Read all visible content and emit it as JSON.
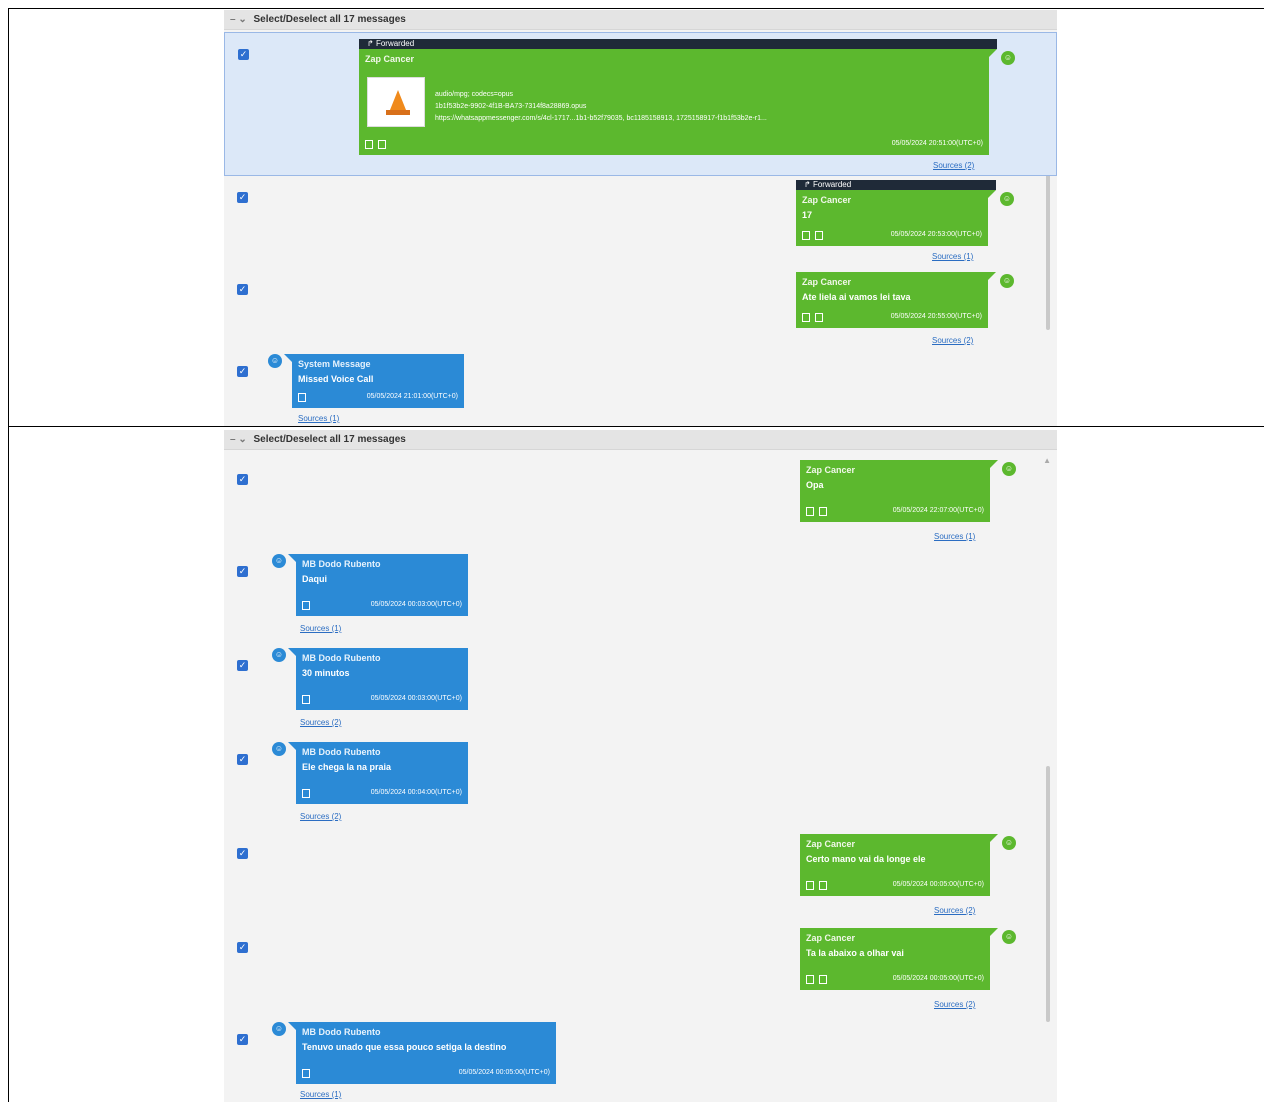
{
  "header": {
    "select_all_top": "Select/Deselect all 17 messages",
    "select_all_bottom": "Select/Deselect all 17 messages"
  },
  "labels": {
    "forwarded": "Forwarded",
    "sources_1": "Sources (1)",
    "sources_2": "Sources (2)"
  },
  "colors": {
    "green": "#5cb82e",
    "blue": "#2b8ad6",
    "dark": "#1f2a38",
    "check": "#2e6fd0"
  },
  "top_panel": {
    "messages": [
      {
        "sender": "Zap Cancer",
        "file_lines": [
          "audio/mpg; codecs=opus",
          "1b1f53b2e-9902-4f1B-BA73-7314f8a28869.opus",
          "https://whatsappmessenger.com/s/4cl-1717...1b1-b52f79035, bc1185158913, 1725158917-f1b1f53b2e-r1..."
        ],
        "timestamp": "05/05/2024 20:51:00(UTC+0)",
        "sources": "Sources (2)"
      },
      {
        "sender": "Zap Cancer",
        "text": "17",
        "timestamp": "05/05/2024 20:53:00(UTC+0)",
        "sources": "Sources (1)"
      },
      {
        "sender": "Zap Cancer",
        "text": "Ate liela ai vamos lei tava",
        "timestamp": "05/05/2024 20:55:00(UTC+0)",
        "sources": "Sources (2)"
      },
      {
        "sender": "System Message",
        "text": "Missed Voice Call",
        "timestamp": "05/05/2024 21:01:00(UTC+0)",
        "sources": "Sources (1)"
      }
    ]
  },
  "bottom_panel": {
    "messages": [
      {
        "sender": "Zap Cancer",
        "text": "Opa",
        "timestamp": "05/05/2024 22:07:00(UTC+0)",
        "sources": "Sources (1)"
      },
      {
        "sender": "MB Dodo Rubento",
        "text": "Daqui",
        "timestamp": "05/05/2024 00:03:00(UTC+0)",
        "sources": "Sources (1)"
      },
      {
        "sender": "MB Dodo Rubento",
        "text": "30 minutos",
        "timestamp": "05/05/2024 00:03:00(UTC+0)",
        "sources": "Sources (2)"
      },
      {
        "sender": "MB Dodo Rubento",
        "text": "Ele chega la na praia",
        "timestamp": "05/05/2024 00:04:00(UTC+0)",
        "sources": "Sources (2)"
      },
      {
        "sender": "Zap Cancer",
        "text": "Certo mano vai da longe ele",
        "timestamp": "05/05/2024 00:05:00(UTC+0)",
        "sources": "Sources (2)"
      },
      {
        "sender": "Zap Cancer",
        "text": "Ta la abaixo a olhar vai",
        "timestamp": "05/05/2024 00:05:00(UTC+0)",
        "sources": "Sources (2)"
      },
      {
        "sender": "MB Dodo Rubento",
        "text": "Tenuvo unado que essa pouco setiga la destino",
        "timestamp": "05/05/2024 00:05:00(UTC+0)",
        "sources": "Sources (1)"
      }
    ]
  }
}
